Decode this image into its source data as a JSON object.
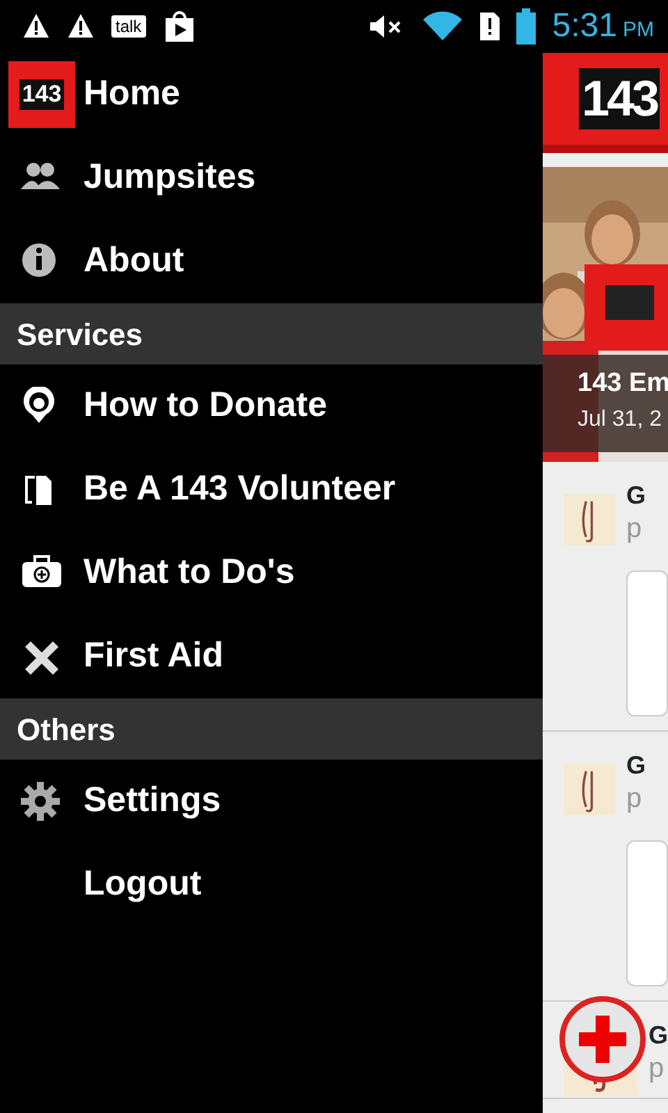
{
  "status_bar": {
    "time": "5:31",
    "ampm": "PM",
    "talk_label": "talk"
  },
  "drawer": {
    "sections": [
      {
        "items": [
          {
            "label": "Home",
            "kind": "logo",
            "logo_text": "143"
          },
          {
            "label": "Jumpsites",
            "kind": "people"
          },
          {
            "label": "About",
            "kind": "info"
          }
        ]
      },
      {
        "header": "Services",
        "items": [
          {
            "label": "How to Donate",
            "kind": "donate"
          },
          {
            "label": "Be A 143 Volunteer",
            "kind": "volunteer"
          },
          {
            "label": "What to Do's",
            "kind": "kit"
          },
          {
            "label": "First Aid",
            "kind": "bandage"
          }
        ]
      },
      {
        "header": "Others",
        "items": [
          {
            "label": "Settings",
            "kind": "gear"
          },
          {
            "label": "Logout",
            "kind": "none"
          }
        ]
      }
    ]
  },
  "content": {
    "header_logo": "143",
    "news": {
      "kind": "picture",
      "title": "143 Em",
      "date": "Jul 31, 2"
    },
    "feed": [
      {
        "title": "G",
        "subtitle": "p",
        "card": true
      },
      {
        "title": "G",
        "subtitle": "p",
        "card": true
      },
      {
        "title": "G",
        "subtitle": "p",
        "card": false
      }
    ]
  }
}
